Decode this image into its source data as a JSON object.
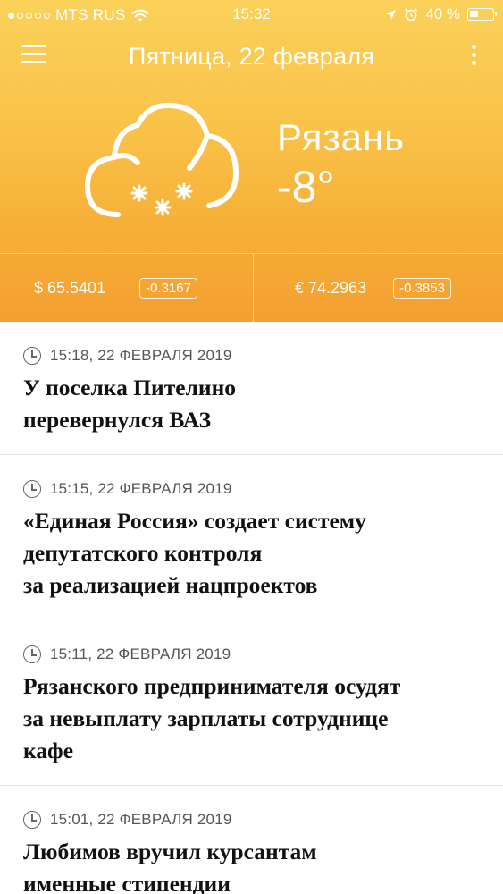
{
  "status_bar": {
    "carrier": "MTS RUS",
    "time": "15:32",
    "battery": "40 %",
    "battery_level": 0.4,
    "icons": [
      "signal-dots-icon",
      "wifi-icon",
      "location-arrow-icon",
      "alarm-icon",
      "battery-icon"
    ]
  },
  "header": {
    "date": "Пятница, 22 февраля",
    "menu_icon": "hamburger-menu-icon",
    "more_icon": "vertical-dots-icon"
  },
  "weather": {
    "icon": "cloud-snow-icon",
    "city": "Рязань",
    "temperature": "-8°"
  },
  "rates": {
    "usd": {
      "value": "$ 65.5401",
      "change": "-0.3167"
    },
    "eur": {
      "value": "€ 74.2963",
      "change": "-0.3853"
    }
  },
  "news": [
    {
      "time": "15:18, 22 ФЕВРАЛЯ 2019",
      "title_lines": [
        "У поселка Пителино",
        "перевернулся ВАЗ"
      ]
    },
    {
      "time": "15:15, 22 ФЕВРАЛЯ 2019",
      "title_lines": [
        "«Единая Россия» создает систему",
        "депутатского контроля",
        "за реализацией нацпроектов"
      ]
    },
    {
      "time": "15:11, 22 ФЕВРАЛЯ 2019",
      "title_lines": [
        "Рязанского предпринимателя осудят",
        "за невыплату зарплаты сотруднице",
        "кафе"
      ]
    },
    {
      "time": "15:01, 22 ФЕВРАЛЯ 2019",
      "title_lines": [
        "Любимов вручил курсантам",
        "именные стипендии"
      ]
    }
  ],
  "colors": {
    "header_top": "#fbd15a",
    "header_bottom": "#f49f30",
    "text_on_header": "#ffffff",
    "headline": "#111111",
    "meta": "#555555"
  }
}
